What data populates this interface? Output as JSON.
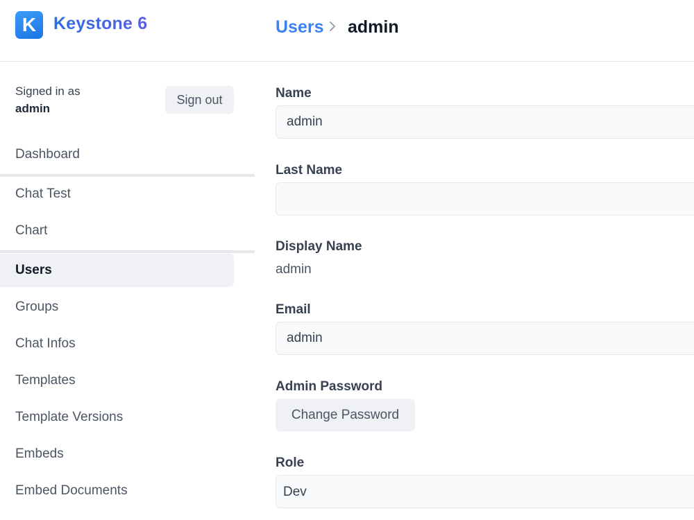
{
  "app": {
    "logo_letter": "K",
    "name": "Keystone 6"
  },
  "breadcrumb": {
    "parent": "Users",
    "current": "admin"
  },
  "session": {
    "signed_in_label": "Signed in as",
    "user": "admin",
    "sign_out_label": "Sign out"
  },
  "nav": {
    "dashboard": "Dashboard",
    "items": [
      "Chat Test",
      "Chart",
      "Users",
      "Groups",
      "Chat Infos",
      "Templates",
      "Template Versions",
      "Embeds",
      "Embed Documents"
    ],
    "active": "Users"
  },
  "form": {
    "name": {
      "label": "Name",
      "value": "admin"
    },
    "last_name": {
      "label": "Last Name",
      "value": ""
    },
    "display_name": {
      "label": "Display Name",
      "value": "admin"
    },
    "email": {
      "label": "Email",
      "value": "admin"
    },
    "admin_password": {
      "label": "Admin Password",
      "button": "Change Password"
    },
    "role": {
      "label": "Role",
      "value": "Dev"
    }
  },
  "colors": {
    "accent": "#3b82f6",
    "logo": "#1c74e4",
    "nav_active_bg": "#eff1f4",
    "input_bg": "#f9fafb"
  }
}
